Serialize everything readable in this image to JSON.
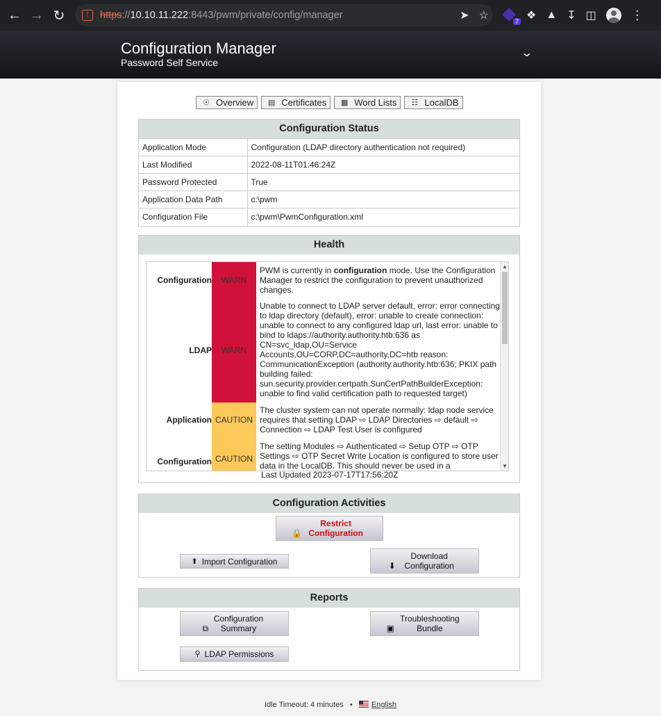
{
  "browser": {
    "url_scheme": "https",
    "url_sep": "://",
    "url_host": "10.10.11.222",
    "url_path": ":8443/pwm/private/config/manager",
    "extension_badge": "7"
  },
  "header": {
    "title": "Configuration Manager",
    "subtitle": "Password Self Service"
  },
  "tabs": [
    {
      "label": "Overview",
      "icon": "dashboard-icon"
    },
    {
      "label": "Certificates",
      "icon": "file-icon"
    },
    {
      "label": "Word Lists",
      "icon": "book-icon"
    },
    {
      "label": "LocalDB",
      "icon": "database-icon"
    }
  ],
  "config_status": {
    "heading": "Configuration Status",
    "rows": [
      {
        "key": "Application Mode",
        "value": "Configuration (LDAP directory authentication not required)"
      },
      {
        "key": "Last Modified",
        "value": "2022-08-11T01:46:24Z"
      },
      {
        "key": "Password Protected",
        "value": "True"
      },
      {
        "key": "Application Data Path",
        "value": "c:\\pwm"
      },
      {
        "key": "Configuration File",
        "value": "c:\\pwm\\PwmConfiguration.xml"
      }
    ]
  },
  "health": {
    "heading": "Health",
    "records": [
      {
        "topic": "Configuration",
        "status": "WARN",
        "detail_pre": "PWM is currently in ",
        "detail_bold": "configuration",
        "detail_post": " mode. Use the Configuration Manager to restrict the configuration to prevent unauthorized changes."
      },
      {
        "topic": "LDAP",
        "status": "WARN",
        "detail": "Unable to connect to LDAP server default, error: error connecting to ldap directory (default), error: unable to create connection: unable to connect to any configured ldap url, last error: unable to bind to ldaps://authority.authority.htb:636 as CN=svc_ldap,OU=Service Accounts,OU=CORP,DC=authority,DC=htb reason: CommunicationException (authority.authority.htb:636; PKIX path building failed: sun.security.provider.certpath.SunCertPathBuilderException: unable to find valid certification path to requested target)"
      },
      {
        "topic": "Application",
        "status": "CAUTION",
        "detail": "The cluster system can not operate normally: ldap node service requires that setting LDAP ⇨ LDAP Directories ⇨ default ⇨ Connection ⇨ LDAP Test User is configured"
      },
      {
        "topic": "Configuration",
        "status": "CAUTION",
        "detail": "The setting Modules ⇨ Authenticated ⇨ Setup OTP ⇨ OTP Settings ⇨ OTP Secret Write Location is configured to store user data in the LocalDB. This should never be used in a"
      }
    ],
    "last_updated": "Last Updated 2023-07-17T17:56:20Z"
  },
  "activities": {
    "heading": "Configuration Activities",
    "restrict_label": "Restrict Configuration",
    "import_label": "Import Configuration",
    "download_label": "Download Configuration"
  },
  "reports": {
    "heading": "Reports",
    "summary_label": "Configuration Summary",
    "troubleshoot_label": "Troubleshooting Bundle",
    "ldap_perm_label": "LDAP Permissions"
  },
  "footer": {
    "idle": "Idle Timeout: 4 minutes",
    "separator": "•",
    "language": "English"
  },
  "colors": {
    "warn": "#d0113a",
    "caution": "#fbc85a",
    "section_head": "#d6dfdb",
    "restrict_text": "#d10f0f"
  }
}
